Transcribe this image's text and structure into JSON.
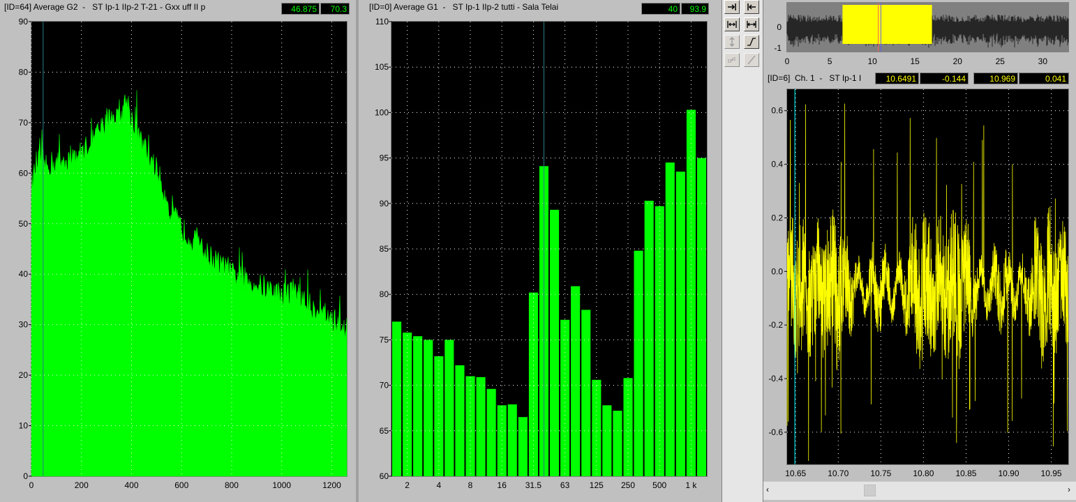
{
  "panel1": {
    "title": "[ID=64] Average G2  -   ST Ip-1 IIp-2 T-21 - Gxx uff II p",
    "readout1": "46.875",
    "readout2": "70.3",
    "y_ticks": [
      "0",
      "10",
      "20",
      "30",
      "40",
      "50",
      "60",
      "70",
      "80",
      "90"
    ],
    "x_ticks": [
      "0",
      "200",
      "400",
      "600",
      "800",
      "1000",
      "1200"
    ]
  },
  "panel2": {
    "title": "[ID=0] Average G1  -   ST Ip-1 IIp-2 tutti - Sala Telai",
    "readout1": "40",
    "readout2": "93.9",
    "y_ticks": [
      "60",
      "65",
      "70",
      "75",
      "80",
      "85",
      "90",
      "95",
      "100",
      "105",
      "110"
    ],
    "x_ticks": [
      "2",
      "4",
      "8",
      "16",
      "31.5",
      "63",
      "125",
      "250",
      "500",
      "1 k"
    ]
  },
  "overview": {
    "y_ticks": [
      "0",
      "-1"
    ],
    "x_ticks": [
      "0",
      "5",
      "10",
      "15",
      "20",
      "25",
      "30"
    ]
  },
  "panel3": {
    "title": "[ID=6]  Ch. 1  -   ST Ip-1 I",
    "readout1": "10.6491",
    "readout2": "-0.144",
    "readout3": "10.969",
    "readout4": "0.041",
    "y_ticks": [
      "0.6",
      "0.4",
      "0.2",
      "0.0",
      "-0.2",
      "-0.4",
      "-0.6"
    ],
    "x_ticks": [
      "10.65",
      "10.70",
      "10.75",
      "10.80",
      "10.85",
      "10.90",
      "10.95"
    ]
  },
  "toolbar": {
    "icons": [
      "cursor-right-icon",
      "cursor-left-icon",
      "zoom-fit-icon",
      "zoom-range-icon",
      "scale-y-icon",
      "curve-icon",
      "curve-alt-icon",
      "line-icon"
    ]
  },
  "colors": {
    "spectrum": "#00ff00",
    "waveform": "#ffff00",
    "cursor": "#00ffff",
    "plot_bg": "#000000",
    "overview_bg": "#808080"
  },
  "chart_data": [
    {
      "type": "area",
      "ylim": [
        0,
        90
      ],
      "xlim": [
        0,
        1260
      ],
      "cursor_x": 46.875,
      "x": [
        0,
        20,
        40,
        60,
        80,
        100,
        150,
        200,
        250,
        300,
        330,
        350,
        380,
        400,
        430,
        450,
        500,
        550,
        600,
        700,
        800,
        900,
        1000,
        1050,
        1100,
        1150,
        1200,
        1260
      ],
      "y": [
        57,
        62,
        63,
        61,
        62,
        62,
        63,
        64,
        67,
        70,
        72,
        70,
        75,
        71,
        67,
        65,
        61,
        53,
        49,
        44,
        40,
        38,
        36,
        37,
        34,
        33,
        31,
        29
      ]
    },
    {
      "type": "bar",
      "ylim": [
        60,
        110
      ],
      "cursor_band": "40",
      "values": [
        77,
        75.8,
        75.4,
        75.0,
        73.2,
        75.0,
        72.2,
        71.0,
        70.9,
        69.6,
        67.8,
        67.9,
        66.5,
        80.2,
        94.1,
        89.3,
        77.2,
        80.9,
        78.3,
        70.6,
        67.8,
        67.2,
        70.8,
        84.8,
        90.3,
        89.7,
        94.5,
        93.5,
        100.3,
        95.0
      ]
    },
    {
      "type": "line",
      "ylim": [
        -0.72,
        0.68
      ],
      "xlim": [
        10.64,
        10.97
      ],
      "cursor_x": 10.6491
    }
  ]
}
